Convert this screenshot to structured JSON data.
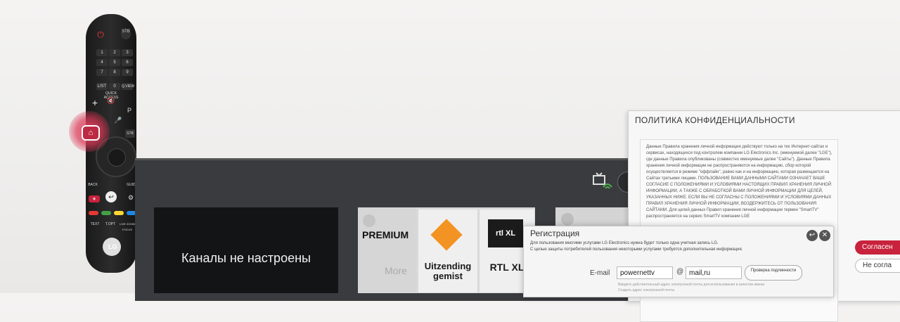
{
  "remote": {
    "stb_label": "STB",
    "numbers": [
      "1",
      "2",
      "3",
      "4",
      "5",
      "6",
      "7",
      "8",
      "9",
      "LIST",
      "0",
      "Q.VIEW"
    ],
    "quick_access": "QUICK ACCESS",
    "p_label": "P",
    "stb2_label": "STB",
    "back_label": "BACK",
    "guide_label": "GUIDE",
    "text_label": "TEXT",
    "topt_label": "T.OPT",
    "livezoom_label": "LIVE ZOOM",
    "focus_label": "FOCUS",
    "brand": "LG"
  },
  "tv": {
    "channel_message": "Каналы не настроены"
  },
  "apps": {
    "premium": "PREMIUM",
    "more": "More",
    "uitzending": "Uitzending gemist",
    "rtl_logo": "rtl XL",
    "rtl": "RTL XL"
  },
  "privacy": {
    "title": "ПОЛИТИКА КОНФИДЕНЦИАЛЬНОСТИ",
    "body": "Данные Правила хранения личной информации действуют только на тех Интернет-сайтах и сервисах, находящихся под контролем компании LG Electronics Inc. (именуемой далее \"LGE\"), где данные Правила опубликованы (совместно именуемые далее \"Сайты\"). Данные Правила хранения личной информации не распространяются на информацию, сбор которой осуществляется в режиме \"оффлайн\", равно как и на информацию, которая размещается на Сайтах третьими лицами. ПОЛЬЗОВАНИЕ ВАМИ ДАННЫМИ САЙТАМИ ОЗНАЧАЕТ ВАШЕ СОГЛАСИЕ С ПОЛОЖЕНИЯМИ И УСЛОВИЯМИ НАСТОЯЩИХ ПРАВИЛ ХРАНЕНИЯ ЛИЧНОЙ ИНФОРМАЦИИ, А ТАКЖЕ С ОБРАБОТКОЙ ВАМИ ЛИЧНОЙ ИНФОРМАЦИИ ДЛЯ ЦЕЛЕЙ, УКАЗАННЫХ НИЖЕ. ЕСЛИ ВЫ НЕ СОГЛАСНЫ С ПОЛОЖЕНИЯМИ И УСЛОВИЯМИ ДАННЫХ ПРАВИЛ ХРАНЕНИЯ ЛИЧНОЙ ИНФОРМАЦИИ, ВОЗДЕРЖИТЕСЬ ОТ ПОЛЬЗОВАНИЯ САЙТАМИ. Для целей данных Правил хранения личной информации термин \"SmartTV\" распространяется на сервис SmartTV компании LGE",
    "agree": "Согласен",
    "disagree": "Не согла"
  },
  "registration": {
    "title": "Регистрация",
    "line1": "Для пользования многими услугами LG Electronics нужна будет только одна учетная запись LG.",
    "line2": "С целью защиты потребителей пользования некоторыми услугами требуется дополнительная информация.",
    "email_label": "E-mail",
    "email_value": "powernettv",
    "at": "@",
    "domain_value": "mail,ru",
    "check_label": "Проверка подлинности",
    "hint1": "Введите действительный адрес электронной почты для использования в качестве имени",
    "hint2": "Создать адрес электронной почты"
  },
  "colors": {
    "accent_red": "#c8223c",
    "home_glow": "#e54b64"
  }
}
